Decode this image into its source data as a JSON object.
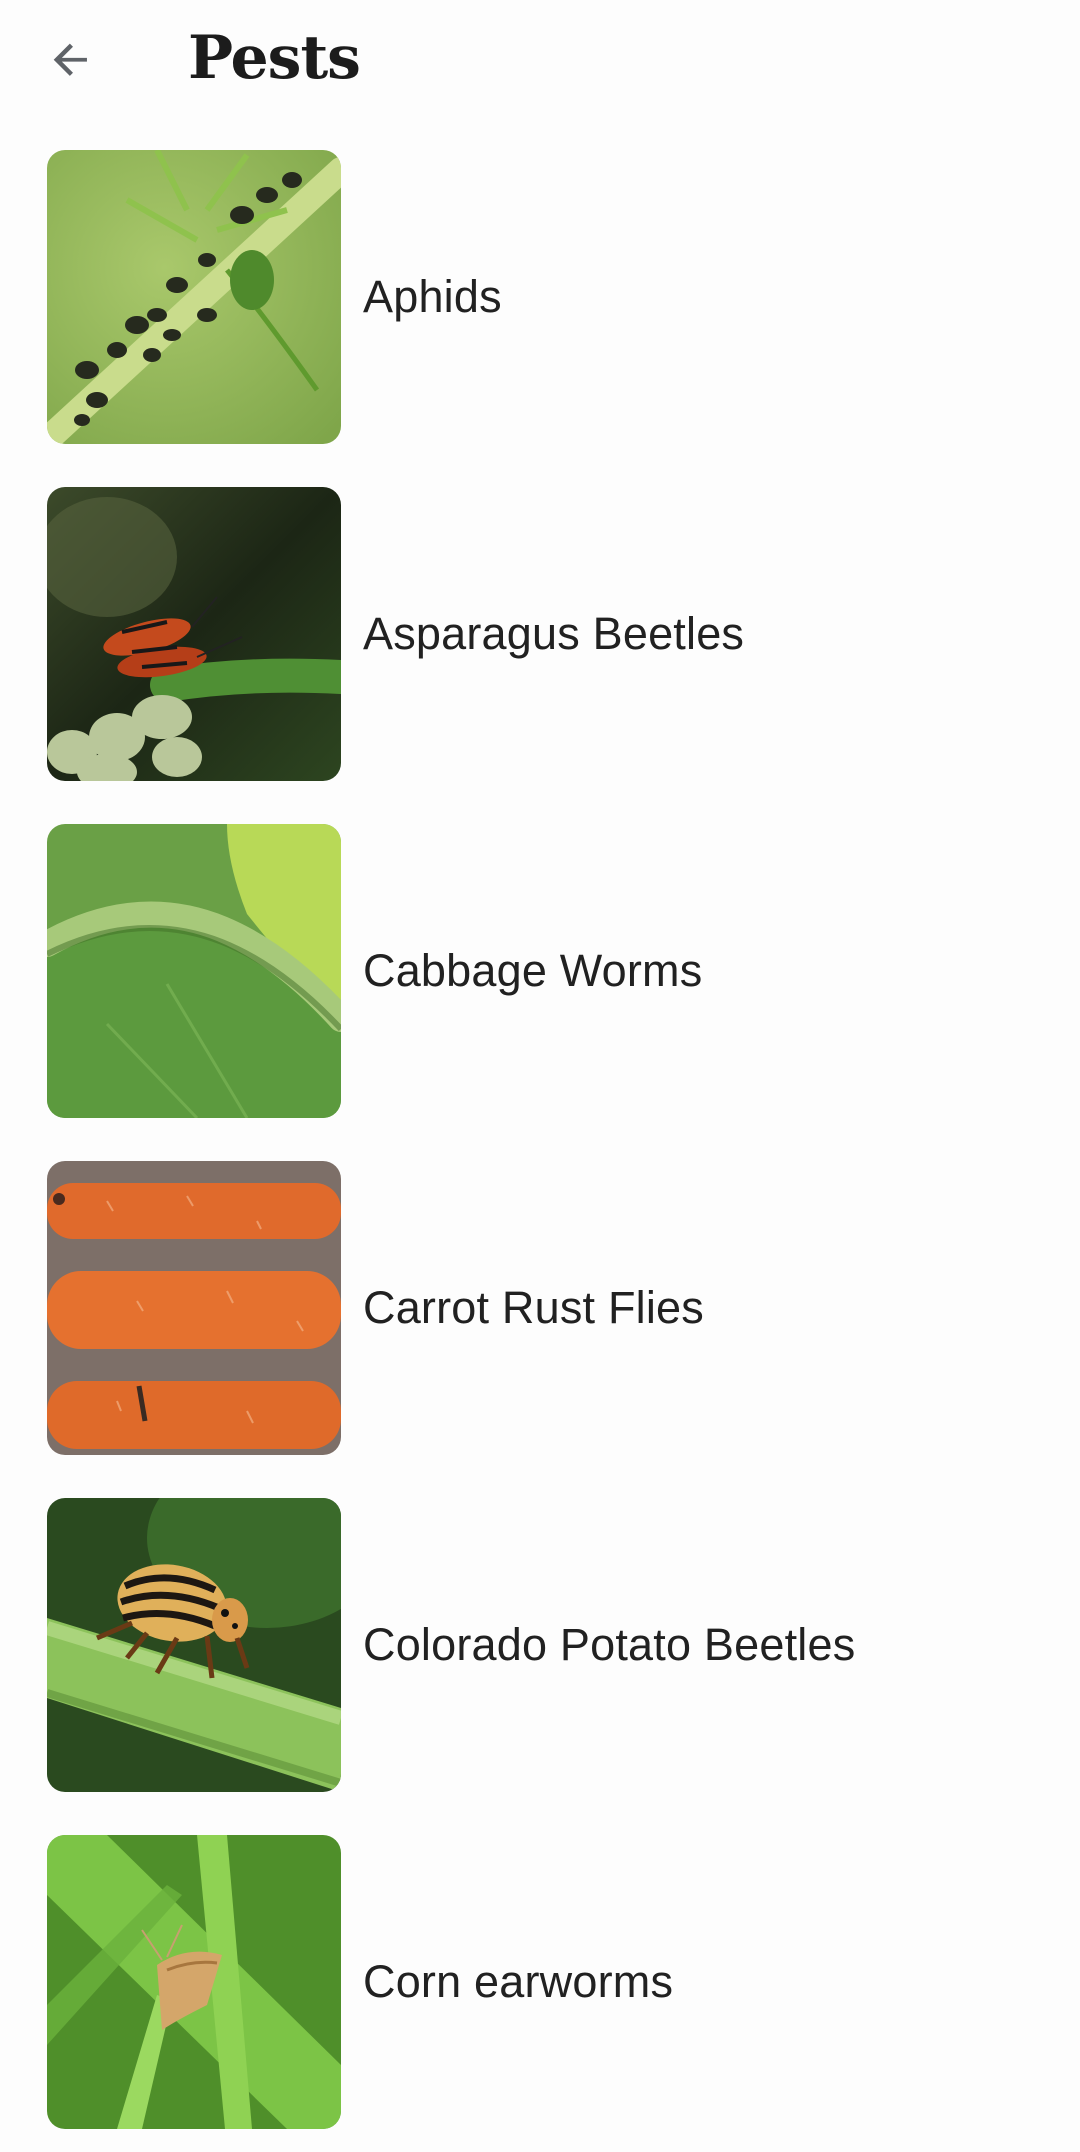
{
  "header": {
    "title": "Pests",
    "back_icon": "arrow-left-icon"
  },
  "colors": {
    "background": "#fdfdfd",
    "text": "#212121",
    "icon": "#5f6368"
  },
  "pests": [
    {
      "label": "Aphids",
      "image": "aphids-photo"
    },
    {
      "label": "Asparagus Beetles",
      "image": "asparagus-beetles-photo"
    },
    {
      "label": "Cabbage Worms",
      "image": "cabbage-worms-photo"
    },
    {
      "label": "Carrot Rust Flies",
      "image": "carrot-rust-flies-photo"
    },
    {
      "label": "Colorado Potato Beetles",
      "image": "colorado-potato-beetles-photo"
    },
    {
      "label": "Corn earworms",
      "image": "corn-earworms-photo"
    }
  ]
}
